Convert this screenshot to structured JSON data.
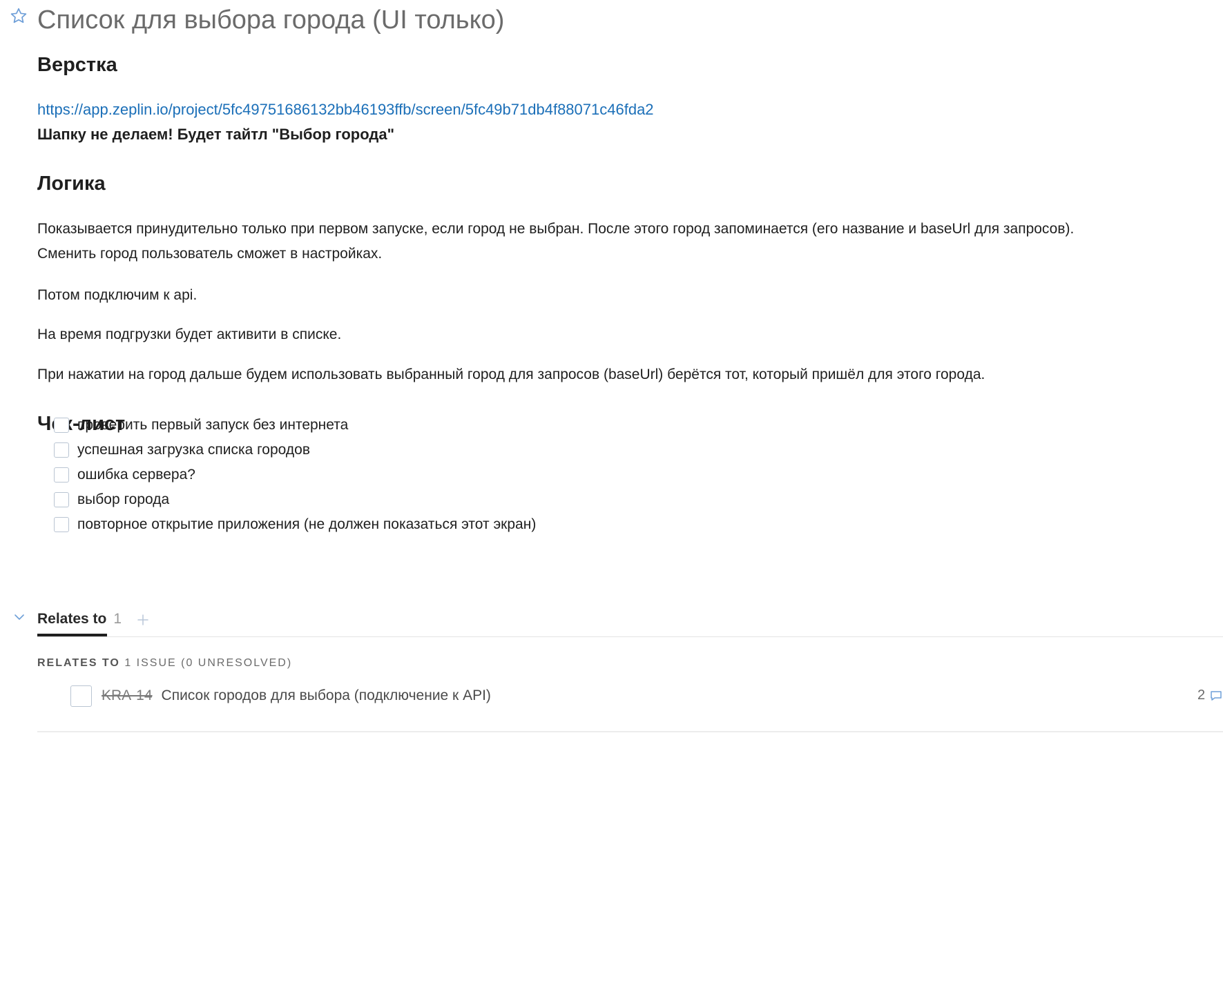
{
  "issue": {
    "title": "Список для выбора города (UI только)"
  },
  "sections": {
    "verstka": {
      "heading": "Верстка",
      "link": "https://app.zeplin.io/project/5fc49751686132bb46193ffb/screen/5fc49b71db4f88071c46fda2",
      "note": "Шапку не делаем! Будет тайтл \"Выбор города\""
    },
    "logika": {
      "heading": "Логика",
      "paragraph1_line1": "Показывается принудительно только при первом запуске, если город не выбран. После этого город запоминается (его название и baseUrl для запросов).",
      "paragraph1_line2": "Сменить город пользователь сможет в настройках.",
      "paragraph2": "Потом подключим к api.",
      "paragraph3": "На время подгрузки будет активити в списке.",
      "paragraph4": "При нажатии на город дальше будем использовать выбранный город для запросов (baseUrl) берётся тот, который пришёл для этого города."
    },
    "checklist": {
      "heading": "Чек-лист",
      "items": [
        {
          "label": "проверить первый запуск без интернета",
          "checked": false
        },
        {
          "label": "успешная загрузка списка городов",
          "checked": false
        },
        {
          "label": "ошибка сервера?",
          "checked": false
        },
        {
          "label": "выбор города",
          "checked": false
        },
        {
          "label": "повторное открытие приложения (не должен показаться этот экран)",
          "checked": false
        }
      ]
    }
  },
  "relates": {
    "tab_label": "Relates to",
    "tab_count": "1",
    "summary_prefix": "RELATES TO",
    "summary_rest": "1 ISSUE (0 UNRESOLVED)",
    "items": [
      {
        "key": "KRA-14",
        "title": "Список городов для выбора (подключение к API)",
        "comments": "2",
        "resolved": true
      }
    ]
  },
  "icons": {
    "star": "star-outline-icon",
    "chevron": "chevron-down-icon",
    "add": "plus-icon",
    "comment": "comment-icon"
  },
  "colors": {
    "link": "#1b6fb8",
    "accent": "#6f9fd8",
    "title": "#6b6b6b"
  }
}
